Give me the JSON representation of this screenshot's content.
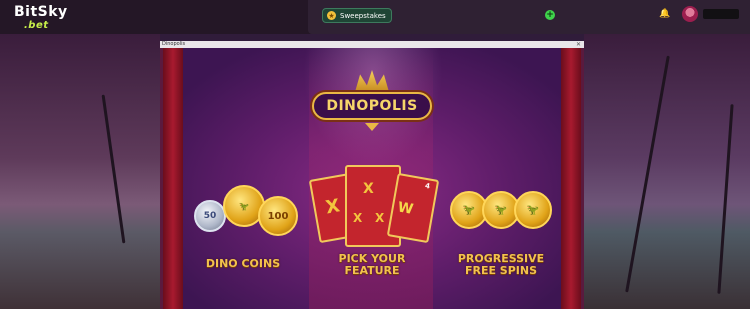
{
  "brand": {
    "name": "BitSky",
    "suffix": ".bet"
  },
  "header": {
    "sweepstakes_label": "Sweepstakes",
    "add_icon": "plus-icon",
    "bell_icon": "bell-icon",
    "avatar_icon": "avatar"
  },
  "game_window": {
    "title": "Dinopolis",
    "close_icon": "close-icon"
  },
  "game": {
    "logo_text": "DINOPOLIS",
    "features": [
      {
        "label": "DINO COINS",
        "coins": [
          "50",
          "",
          "100"
        ]
      },
      {
        "label": "PICK YOUR FEATURE"
      },
      {
        "label": "PROGRESSIVE FREE SPINS"
      }
    ],
    "card_corner_label": "4"
  },
  "colors": {
    "accent_green": "#3fd34b",
    "gold": "#f2c24e",
    "curtain_red": "#a81a2f"
  }
}
